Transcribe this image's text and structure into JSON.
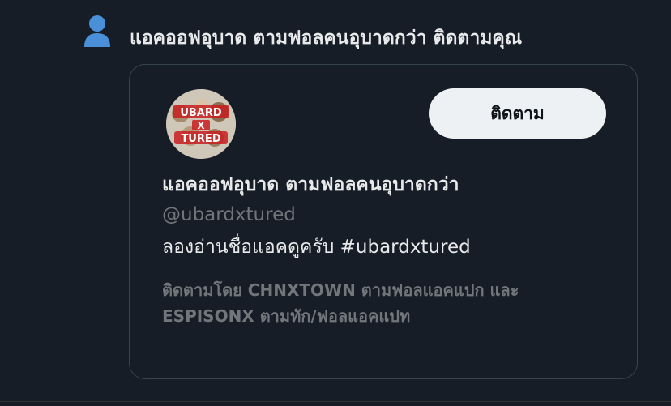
{
  "notification": {
    "icon": "person-icon",
    "icon_color": "#4a90d9",
    "text": "แอคออฟอุบาด ตามฟอลคนอุบาดกว่า ติดตามคุณ"
  },
  "card": {
    "avatar_text": "UBARD X TURED",
    "follow_button_label": "ติดตาม",
    "display_name": "แอคออฟอุบาด ตามฟอลคนอุบาดกว่า",
    "handle": "@ubardxtured",
    "bio": "ลองอ่านชื่อแอคดูครับ #ubardxtured",
    "followed_by_line1": "ติดตามโดย CHNXTOWN ตามฟอลแอคแปก และ",
    "followed_by_line2": "ESPISONX ตามทัก/ฟอลแอคแปท"
  },
  "colors": {
    "background": "#161d27",
    "primary_text": "#e7e9ea",
    "secondary_text": "#71767b",
    "button_bg": "#eef1f3",
    "border": "#38444d"
  }
}
